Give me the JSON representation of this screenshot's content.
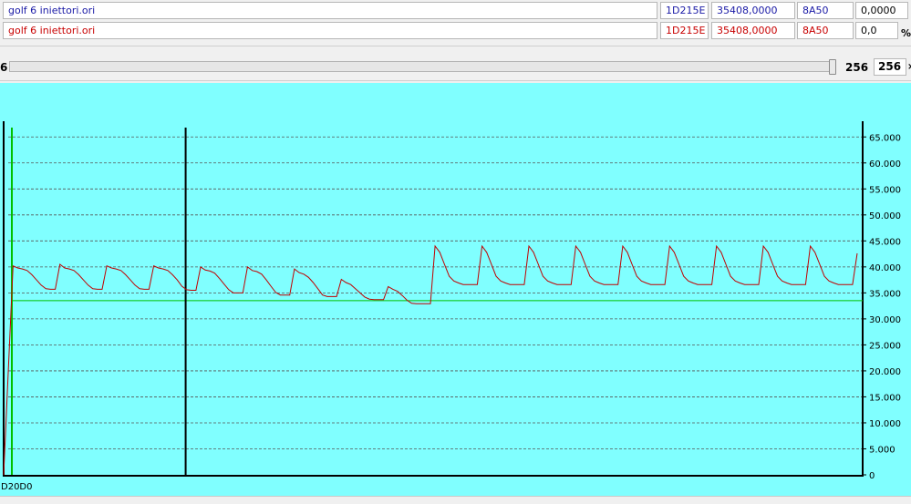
{
  "rows": [
    {
      "file": "golf 6 iniettori.ori",
      "addr": "1D215E",
      "value": "35408,0000",
      "hex": "8A50",
      "extra": "0,0000",
      "unit": ""
    },
    {
      "file": "golf 6 iniettori.ori",
      "addr": "1D215E",
      "value": "35408,0000",
      "hex": "8A50",
      "extra": "0,0",
      "unit": "%"
    }
  ],
  "slider": {
    "left_text": "6",
    "value": "256",
    "input": "256",
    "right_text": "×",
    "position": 1.0
  },
  "colors": {
    "panel": "#80ffff",
    "trace": "#c00000",
    "reference_line": "#00c000",
    "cursor": "#000000",
    "row1_text": "#1a1aa6",
    "row2_text": "#c80000"
  },
  "chart_data": {
    "type": "line",
    "x_start_label": "D20D0",
    "ylim": [
      0,
      67500
    ],
    "yticks": [
      0,
      5000,
      10000,
      15000,
      20000,
      25000,
      30000,
      35000,
      40000,
      45000,
      50000,
      55000,
      60000,
      65000
    ],
    "ytick_labels": [
      "0",
      "5.000",
      "10.000",
      "15.000",
      "20.000",
      "25.000",
      "30.000",
      "35.000",
      "40.000",
      "45.000",
      "50.000",
      "55.000",
      "60.000",
      "65.000"
    ],
    "grid": true,
    "cursor_index": 39,
    "reference_value": 33500,
    "series": [
      {
        "values": [
          0,
          20000,
          40200,
          39800,
          39600,
          39300,
          38500,
          37500,
          36500,
          35800,
          35700,
          35700,
          40500,
          39800,
          39600,
          39300,
          38500,
          37500,
          36500,
          35800,
          35700,
          35700,
          40200,
          39800,
          39600,
          39300,
          38500,
          37500,
          36500,
          35800,
          35700,
          35700,
          40200,
          39800,
          39600,
          39300,
          38500,
          37500,
          36300,
          35600,
          35500,
          35500,
          40000,
          39400,
          39200,
          38800,
          37800,
          36700,
          35600,
          35000,
          35000,
          35000,
          40000,
          39300,
          39100,
          38600,
          37500,
          36300,
          35100,
          34600,
          34600,
          34600,
          39600,
          38900,
          38600,
          38000,
          37000,
          35800,
          34600,
          34300,
          34300,
          34300,
          37600,
          37000,
          36600,
          35800,
          35000,
          34200,
          33800,
          33700,
          33700,
          33700,
          36200,
          35700,
          35300,
          34500,
          33600,
          33000,
          32900,
          32900,
          32900,
          32900,
          44000,
          42800,
          40500,
          38200,
          37300,
          36900,
          36600,
          36600,
          36600,
          36600,
          44000,
          42800,
          40500,
          38200,
          37300,
          36900,
          36600,
          36600,
          36600,
          36600,
          44000,
          42800,
          40500,
          38200,
          37300,
          36900,
          36600,
          36600,
          36600,
          36600,
          44000,
          42800,
          40500,
          38200,
          37300,
          36900,
          36600,
          36600,
          36600,
          36600,
          44000,
          42800,
          40500,
          38200,
          37300,
          36900,
          36600,
          36600,
          36600,
          36600,
          44000,
          42800,
          40500,
          38200,
          37300,
          36900,
          36600,
          36600,
          36600,
          36600,
          44000,
          42800,
          40500,
          38200,
          37300,
          36900,
          36600,
          36600,
          36600,
          36600,
          44000,
          42800,
          40500,
          38200,
          37300,
          36900,
          36600,
          36600,
          36600,
          36600,
          44000,
          42800,
          40500,
          38200,
          37300,
          36900,
          36600,
          36600,
          36600,
          36600,
          42600
        ]
      }
    ]
  }
}
